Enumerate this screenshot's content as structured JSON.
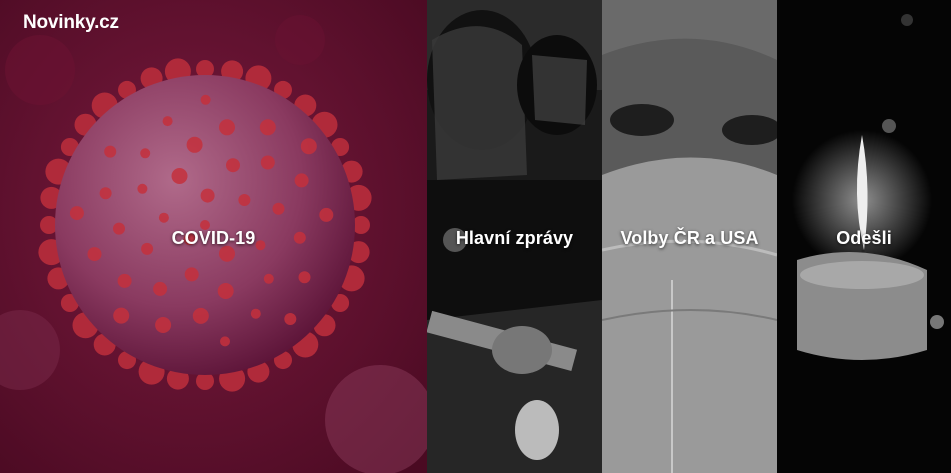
{
  "brand": {
    "logo_text": "Novinky.cz"
  },
  "panels": [
    {
      "label": "COVID-19",
      "tint": "#6b1535"
    },
    {
      "label": "Hlavní zprávy",
      "tint": "#2a2a2a"
    },
    {
      "label": "Volby ČR a USA",
      "tint": "#5a5a5a"
    },
    {
      "label": "Odešli",
      "tint": "#000000"
    }
  ]
}
